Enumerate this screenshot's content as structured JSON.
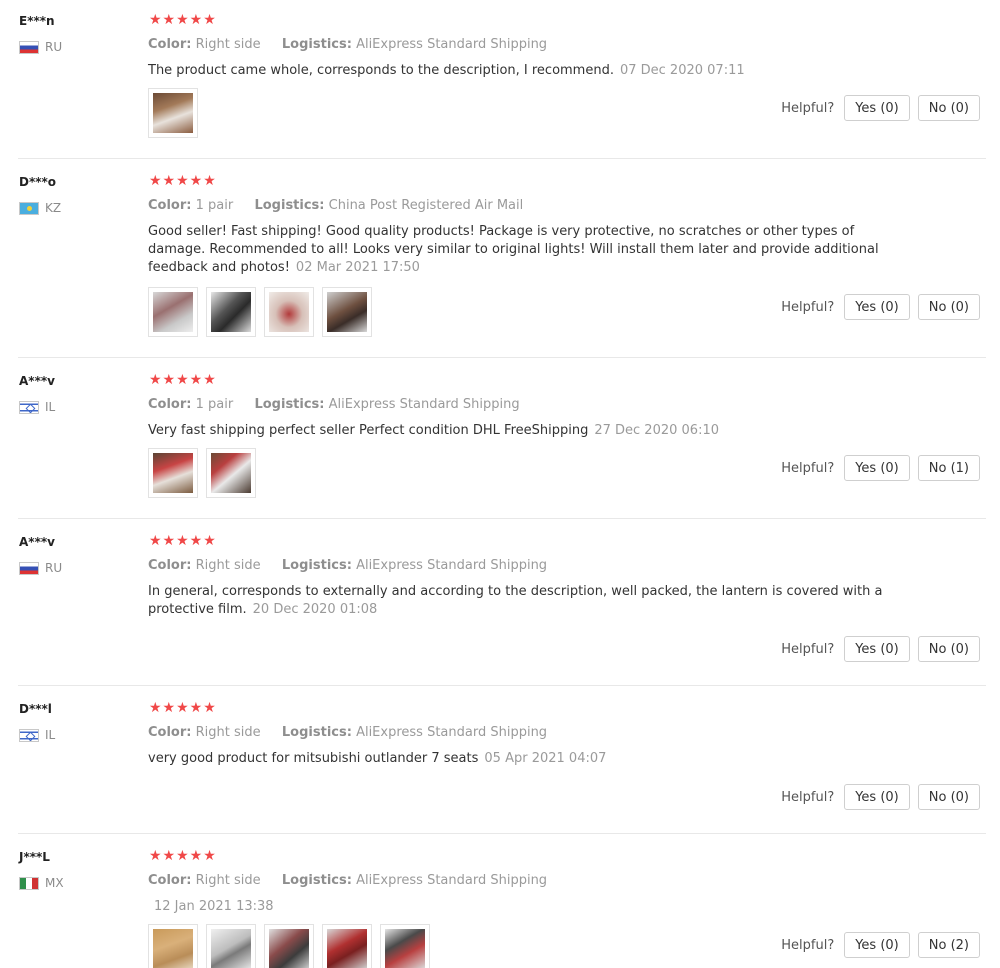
{
  "labels": {
    "color": "Color:",
    "logistics": "Logistics:",
    "helpful": "Helpful?"
  },
  "stars_text": "★★★★★",
  "reviews": [
    {
      "user": "E***n",
      "country": "RU",
      "flag": "ru",
      "color_value": "Right side",
      "logistics_value": "AliExpress Standard Shipping",
      "text": "The product came whole, corresponds to the description, I recommend.",
      "date": "07 Dec 2020 07:11",
      "yes": "Yes (0)",
      "no": "No (0)",
      "rating": 5,
      "photos": [
        "taillight-photo-1"
      ]
    },
    {
      "user": "D***o",
      "country": "KZ",
      "flag": "kz",
      "color_value": "1 pair",
      "logistics_value": "China Post Registered Air Mail",
      "text": "Good seller! Fast shipping! Good quality products! Package is very protective, no scratches or other types of damage. Recommended to all! Looks very similar to original lights! Will install them later and provide additional feedback and photos!",
      "date": "02 Mar 2021 17:50",
      "yes": "Yes (0)",
      "no": "No (0)",
      "rating": 5,
      "photos": [
        "taillight-photo-1",
        "taillight-photo-2",
        "taillight-photo-3",
        "taillight-photo-4"
      ]
    },
    {
      "user": "A***v",
      "country": "IL",
      "flag": "il",
      "color_value": "1 pair",
      "logistics_value": "AliExpress Standard Shipping",
      "text": "Very fast shipping perfect seller Perfect condition DHL FreeShipping",
      "date": "27 Dec 2020 06:10",
      "yes": "Yes (0)",
      "no": "No (1)",
      "rating": 5,
      "photos": [
        "taillight-photo-1",
        "taillight-photo-2"
      ]
    },
    {
      "user": "A***v",
      "country": "RU",
      "flag": "ru",
      "color_value": "Right side",
      "logistics_value": "AliExpress Standard Shipping",
      "text": "In general, corresponds to externally and according to the description, well packed, the lantern is covered with a protective film.",
      "date": "20 Dec 2020 01:08",
      "yes": "Yes (0)",
      "no": "No (0)",
      "rating": 5,
      "photos": []
    },
    {
      "user": "D***l",
      "country": "IL",
      "flag": "il",
      "color_value": "Right side",
      "logistics_value": "AliExpress Standard Shipping",
      "text": "very good product for mitsubishi outlander 7 seats",
      "date": "05 Apr 2021 04:07",
      "yes": "Yes (0)",
      "no": "No (0)",
      "rating": 5,
      "photos": []
    },
    {
      "user": "J***L",
      "country": "MX",
      "flag": "mx",
      "color_value": "Right side",
      "logistics_value": "AliExpress Standard Shipping",
      "text": "",
      "date": "12 Jan 2021 13:38",
      "yes": "Yes (0)",
      "no": "No (2)",
      "rating": 5,
      "photos": [
        "taillight-photo-1",
        "taillight-photo-2",
        "taillight-photo-3",
        "taillight-photo-4",
        "taillight-photo-5"
      ]
    }
  ]
}
